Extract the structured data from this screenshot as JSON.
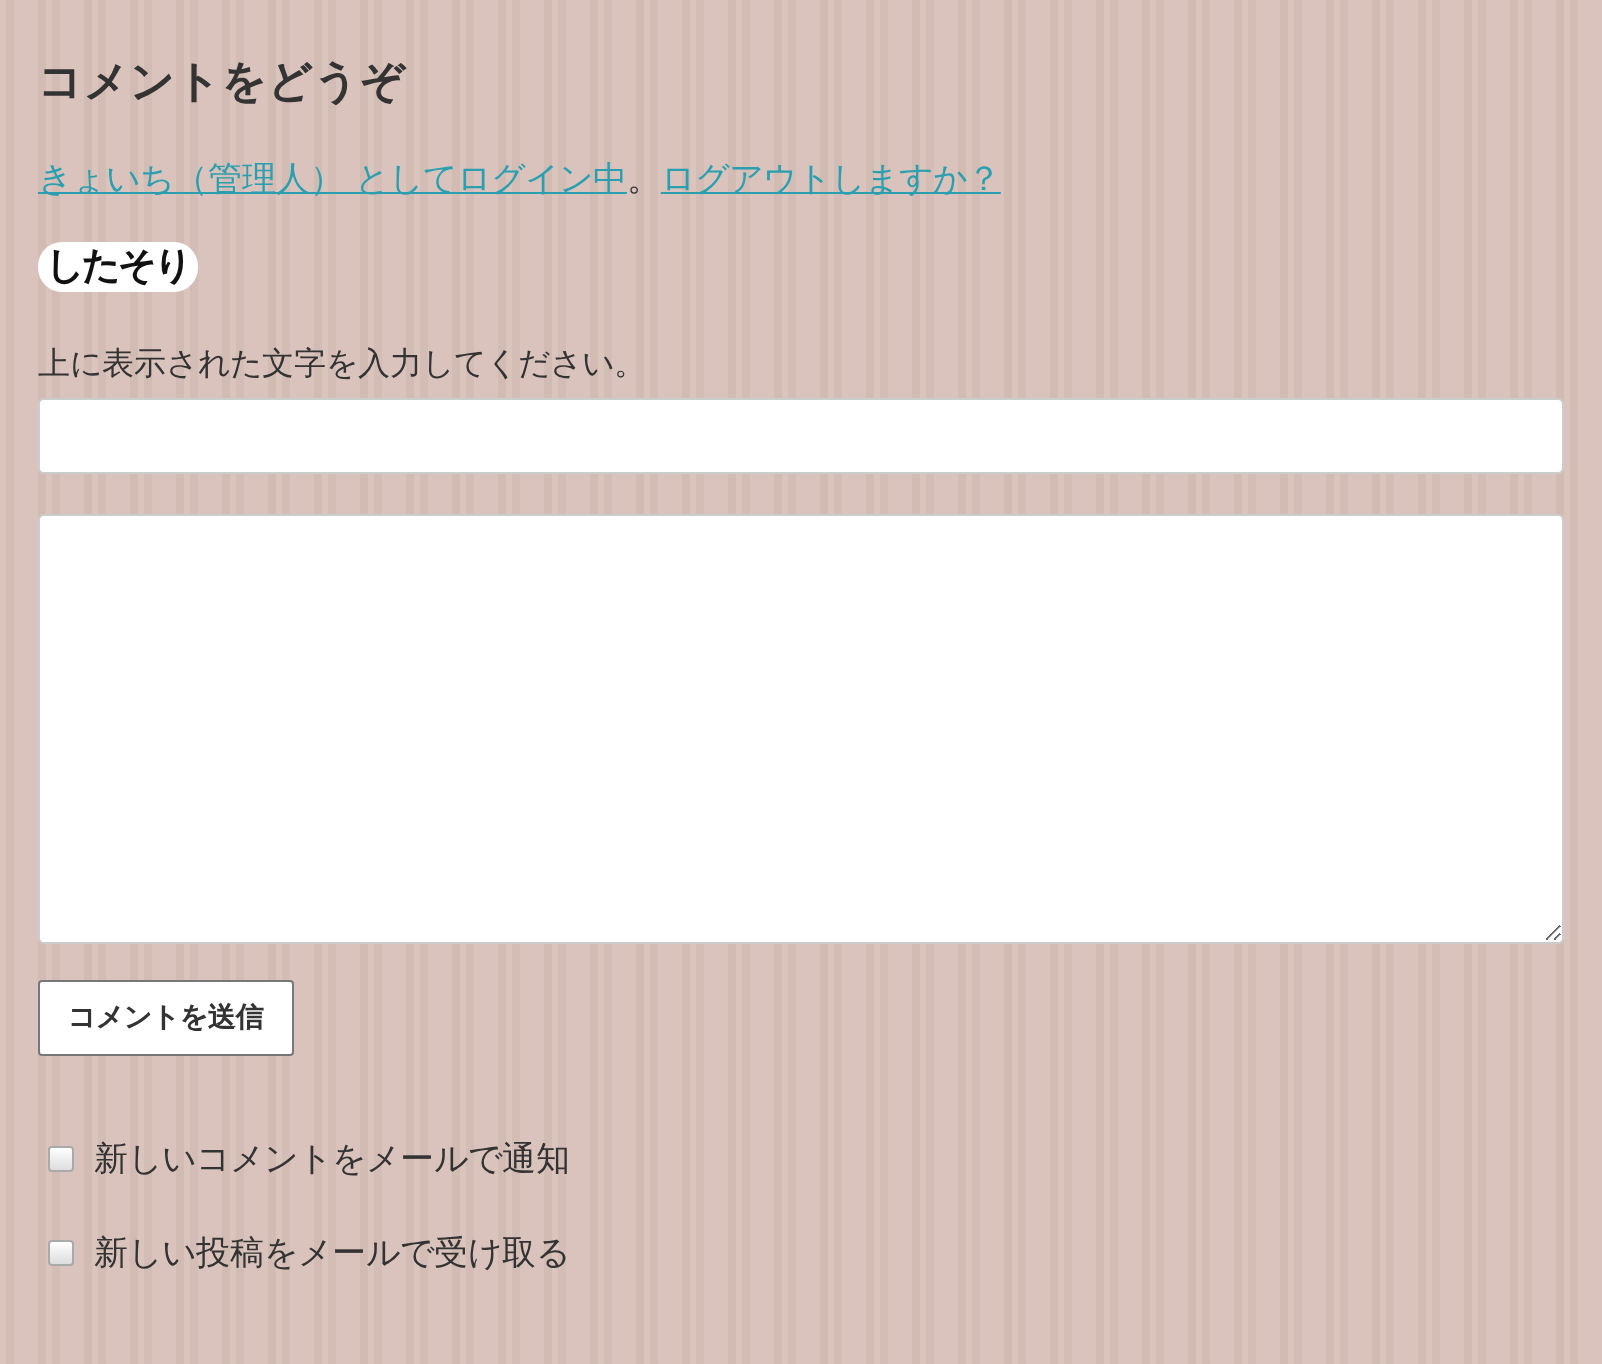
{
  "title": "コメントをどうぞ",
  "login": {
    "user_link": "きょいち（管理人） としてログイン中",
    "separator": "。",
    "logout_link": "ログアウトしますか？"
  },
  "captcha": {
    "text": "したそり"
  },
  "captcha_label": "上に表示された文字を入力してください。",
  "submit": "コメントを送信",
  "options": [
    {
      "label": "新しいコメントをメールで通知",
      "checked": false
    },
    {
      "label": "新しい投稿をメールで受け取る",
      "checked": false
    }
  ]
}
